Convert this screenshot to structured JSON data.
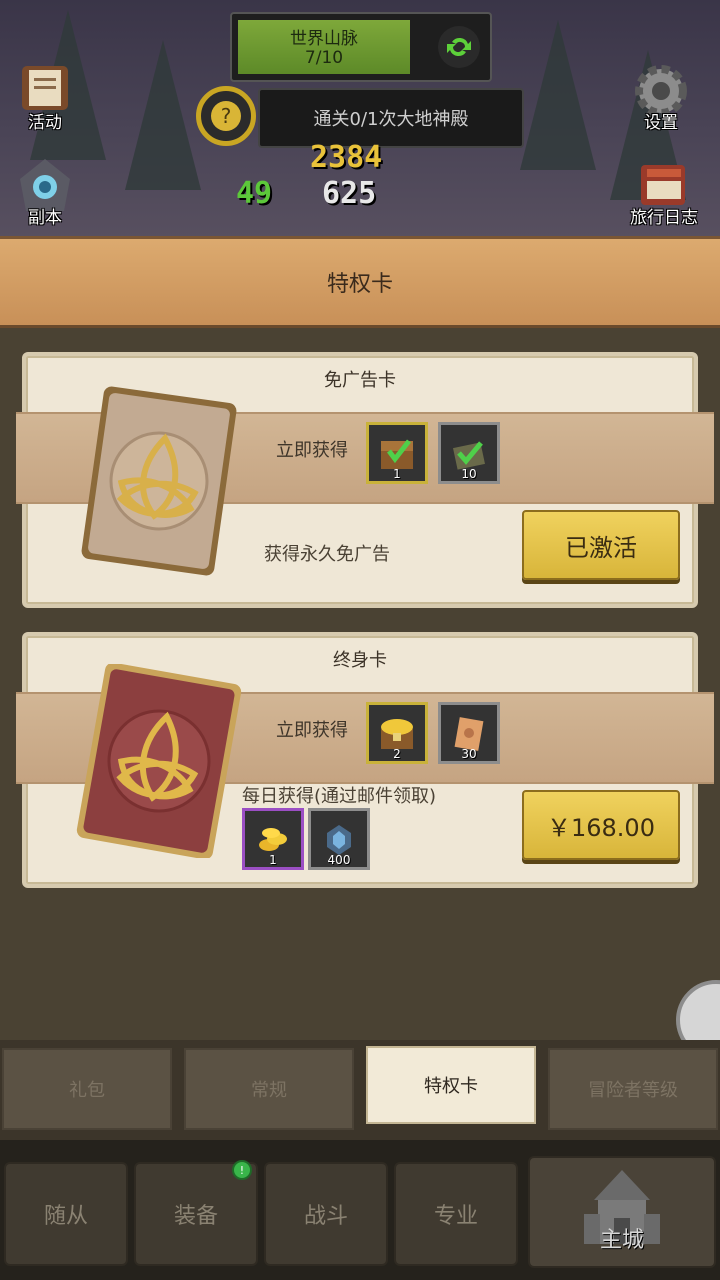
{
  "hud": {
    "world_name": "世界山脉",
    "world_progress": "7/10",
    "world_progress_fraction": 0.7,
    "quest_text": "通关0/1次大地神殿",
    "left_icons": [
      {
        "label": "活动",
        "icon": "activity-scroll-icon"
      },
      {
        "label": "副本",
        "icon": "dungeon-portal-icon"
      }
    ],
    "right_icons": [
      {
        "label": "设置",
        "icon": "gear-icon"
      },
      {
        "label": "旅行日志",
        "icon": "journal-book-icon"
      }
    ],
    "damage_numbers": [
      "2384",
      "625",
      "49"
    ]
  },
  "panel": {
    "title": "特权卡",
    "cards": [
      {
        "title": "免广告卡",
        "get_now_label": "立即获得",
        "rewards_now": [
          {
            "icon": "treasure-chest-icon",
            "count": "1",
            "frame": "gold"
          },
          {
            "icon": "green-check-ticket-icon",
            "count": "10",
            "frame": "gray"
          }
        ],
        "description": "获得永久免广告",
        "button_label": "已激活",
        "art_color": "#b9a088"
      },
      {
        "title": "终身卡",
        "get_now_label": "立即获得",
        "rewards_now": [
          {
            "icon": "gold-chest-icon",
            "count": "2",
            "frame": "gold"
          },
          {
            "icon": "scroll-icon",
            "count": "30",
            "frame": "gray"
          }
        ],
        "daily_label": "每日获得(通过邮件领取)",
        "rewards_daily": [
          {
            "icon": "gold-coins-icon",
            "count": "1",
            "frame": "purple"
          },
          {
            "icon": "blue-gem-icon",
            "count": "400",
            "frame": "gray"
          }
        ],
        "button_label": "￥168.00",
        "art_color": "#8c3f3f"
      }
    ]
  },
  "tabs": [
    {
      "label": "礼包",
      "active": false
    },
    {
      "label": "常规",
      "active": false
    },
    {
      "label": "特权卡",
      "active": true
    },
    {
      "label": "冒险者等级",
      "active": false
    }
  ],
  "nav": [
    {
      "label": "随从",
      "badge": false
    },
    {
      "label": "装备",
      "badge": true
    },
    {
      "label": "战斗",
      "badge": false
    },
    {
      "label": "专业",
      "badge": false
    },
    {
      "label": "主城",
      "badge": false
    }
  ],
  "colors": {
    "accent_gold": "#d8b53a",
    "panel_bg": "#4a4233",
    "card_bg": "#efe7d6",
    "header_bg": "#c89058"
  }
}
